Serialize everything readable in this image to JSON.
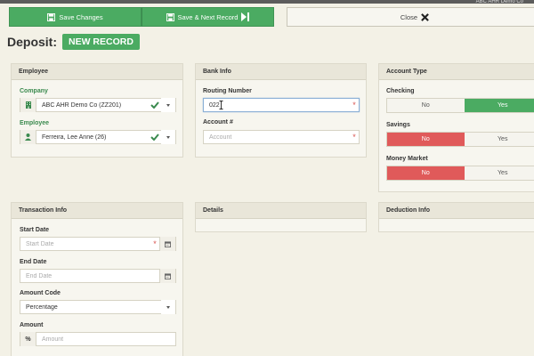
{
  "header": {
    "right_text": "ABC AHR Demo Co"
  },
  "toolbar": {
    "save_label": "Save Changes",
    "save_next_label": "Save & Next Record",
    "close_label": "Close"
  },
  "page": {
    "title": "Deposit:",
    "badge": "NEW RECORD"
  },
  "employee_panel": {
    "header": "Employee",
    "company_label": "Company",
    "company_value": "ABC AHR Demo Co (ZZ201)",
    "employee_label": "Employee",
    "employee_value": "Ferreira, Lee Anne (26)"
  },
  "bank_panel": {
    "header": "Bank Info",
    "routing_label": "Routing Number",
    "routing_value": "022",
    "account_label": "Account #",
    "account_placeholder": "Account"
  },
  "account_type_panel": {
    "header": "Account Type",
    "checking_label": "Checking",
    "savings_label": "Savings",
    "money_market_label": "Money Market",
    "no_label": "No",
    "yes_label": "Yes"
  },
  "transaction_panel": {
    "header": "Transaction Info",
    "start_label": "Start Date",
    "start_placeholder": "Start Date",
    "end_label": "End Date",
    "end_placeholder": "End Date",
    "amount_code_label": "Amount Code",
    "amount_code_value": "Percentage",
    "amount_label": "Amount",
    "amount_prefix": "%",
    "amount_placeholder": "Amount"
  },
  "details_panel": {
    "header": "Details"
  },
  "deduction_panel": {
    "header": "Deduction Info"
  },
  "colors": {
    "accent_green": "#4bab62",
    "required_red": "#d9534f",
    "toggle_red": "#e05a5a"
  }
}
